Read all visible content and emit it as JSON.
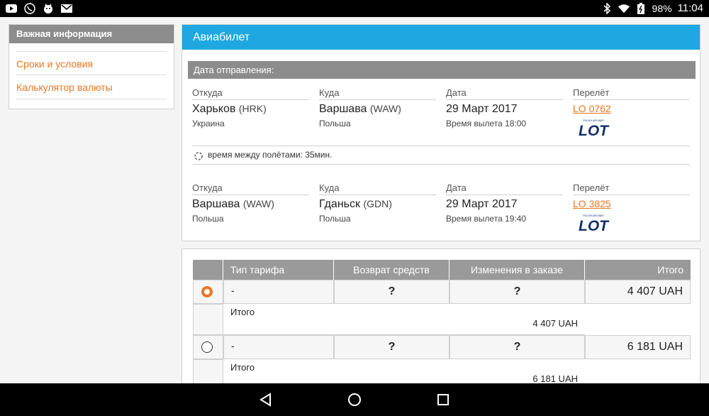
{
  "status_bar": {
    "battery": "98%",
    "time": "11:04",
    "left_icons": [
      "youtube-icon",
      "viber-icon",
      "tiger-app-icon",
      "gmail-icon"
    ],
    "right_icons": [
      "bluetooth-icon",
      "wifi-icon",
      "battery-icon"
    ]
  },
  "sidebar": {
    "title": "Важная информация",
    "links": [
      "Сроки и условия",
      "Калькулятор валюты"
    ]
  },
  "ticket": {
    "title": "Авиабилет",
    "departure_header": "Дата отправления:",
    "segments": [
      {
        "from_label": "Откуда",
        "from_city": "Харьков",
        "from_code": "(HRK)",
        "from_country": "Украина",
        "to_label": "Куда",
        "to_city": "Варшава",
        "to_code": "(WAW)",
        "to_country": "Польша",
        "date_label": "Дата",
        "date": "29 Март 2017",
        "time": "Время вылета 18:00",
        "flight_label": "Перелёт",
        "flight_no": "LO 0762",
        "airline_logo": "LOT"
      },
      {
        "from_label": "Откуда",
        "from_city": "Варшава",
        "from_code": "(WAW)",
        "from_country": "Польша",
        "to_label": "Куда",
        "to_city": "Гданьск",
        "to_code": "(GDN)",
        "to_country": "Польша",
        "date_label": "Дата",
        "date": "29 Март 2017",
        "time": "Время вылета 19:40",
        "flight_label": "Перелёт",
        "flight_no": "LO 3825",
        "airline_logo": "LOT"
      }
    ],
    "transfer": "время между полётами:  35мин."
  },
  "fares": {
    "headers": [
      "Тип тарифа",
      "Возврат средств",
      "Изменения в заказе",
      "Итого"
    ],
    "rows": [
      {
        "selected": true,
        "type": "-",
        "refund": "?",
        "changes": "?",
        "total": "4 407 UAH",
        "sub_label": "Итого",
        "sub_total": "4 407 UAH"
      },
      {
        "selected": false,
        "type": "-",
        "refund": "?",
        "changes": "?",
        "total": "6 181 UAH",
        "sub_label": "Итого",
        "sub_total": "6 181 UAH"
      }
    ]
  },
  "colors": {
    "accent": "#e87722",
    "header_blue": "#1ea7e1",
    "grey_header": "#8c8c8c",
    "lot_blue": "#13306b"
  }
}
